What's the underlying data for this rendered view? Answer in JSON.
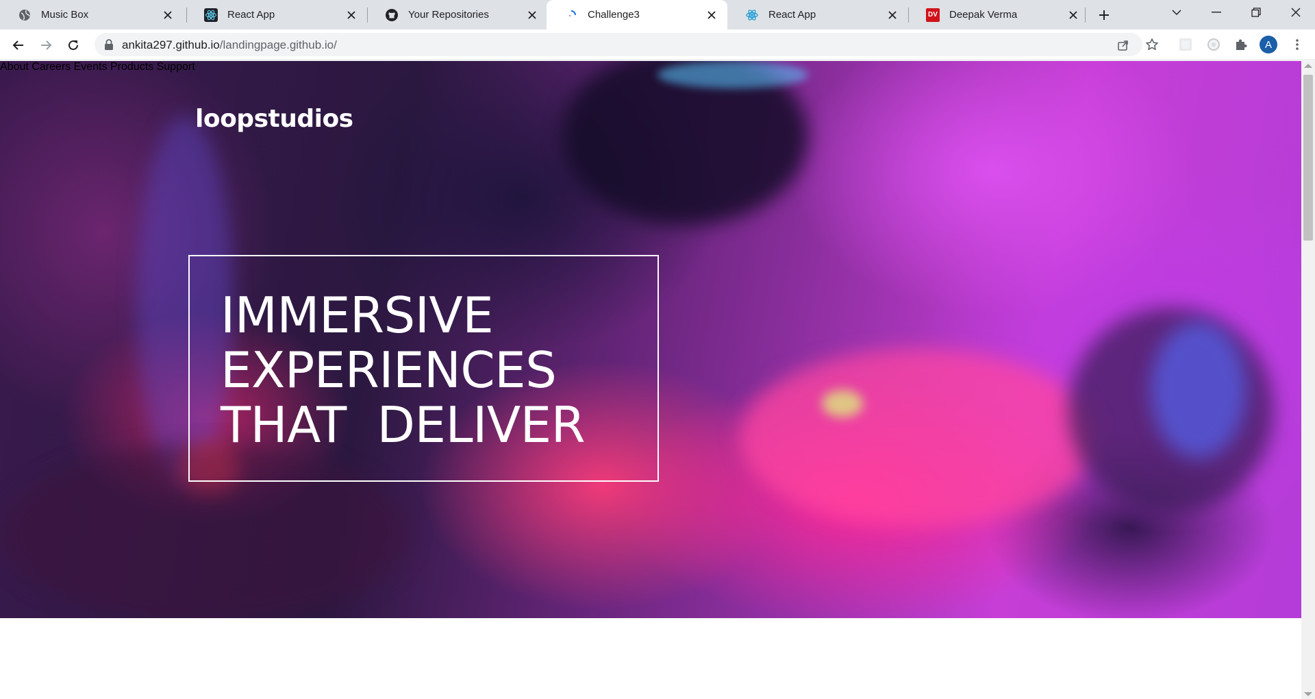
{
  "browser": {
    "tabs": [
      {
        "title": "Music Box",
        "favicon": "globe-icon",
        "active": false
      },
      {
        "title": "React App",
        "favicon": "react-icon",
        "active": false
      },
      {
        "title": "Your Repositories",
        "favicon": "github-icon",
        "active": false
      },
      {
        "title": "Challenge3",
        "favicon": "loading-icon",
        "active": true
      },
      {
        "title": "React App",
        "favicon": "react-icon",
        "active": false
      },
      {
        "title": "Deepak Verma",
        "favicon": "dv-icon",
        "favicon_text": "DV",
        "active": false
      }
    ],
    "url_domain": "ankita297.github.io",
    "url_path": "/landingpage.github.io/",
    "profile_initial": "A",
    "colors": {
      "tabstrip": "#dee1e6",
      "omnibox": "#f1f3f4",
      "avatar": "#1a5fa8",
      "dv_favicon": "#d0121b"
    }
  },
  "page": {
    "brand": "loopstudios",
    "nav": [
      "About",
      "Careers",
      "Events",
      "Products",
      "Support"
    ],
    "headline": [
      "IMMERSIVE",
      "EXPERIENCES",
      "THAT  DELIVER"
    ]
  }
}
